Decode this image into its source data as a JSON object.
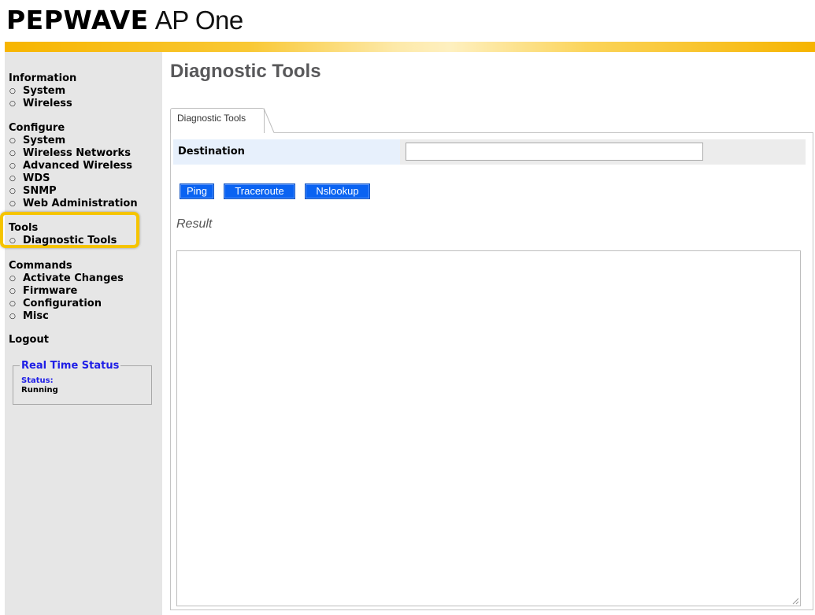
{
  "header": {
    "brand": "PEPWAVE",
    "product": "AP One",
    "accent_color": "#f7b500"
  },
  "sidebar": {
    "groups": [
      {
        "heading": "Information",
        "items": [
          "System",
          "Wireless"
        ]
      },
      {
        "heading": "Configure",
        "items": [
          "System",
          "Wireless Networks",
          "Advanced Wireless",
          "WDS",
          "SNMP",
          "Web Administration"
        ]
      },
      {
        "heading": "Tools",
        "items": [
          "Diagnostic Tools"
        ]
      },
      {
        "heading": "Commands",
        "items": [
          "Activate Changes",
          "Firmware",
          "Configuration",
          "Misc"
        ]
      }
    ],
    "bullet_glyph": "○",
    "highlight_color": "#f5c400",
    "logout_label": "Logout",
    "status": {
      "legend": "Real Time Status",
      "label": "Status:",
      "value": "Running",
      "label_color": "#1e1ee6"
    }
  },
  "main": {
    "title": "Diagnostic Tools",
    "tab_label": "Diagnostic Tools",
    "destination": {
      "label": "Destination",
      "value": "",
      "placeholder": ""
    },
    "buttons": {
      "ping": "Ping",
      "traceroute": "Traceroute",
      "nslookup": "Nslookup"
    },
    "button_color": "#0a63f2",
    "result_label": "Result",
    "result_text": ""
  }
}
